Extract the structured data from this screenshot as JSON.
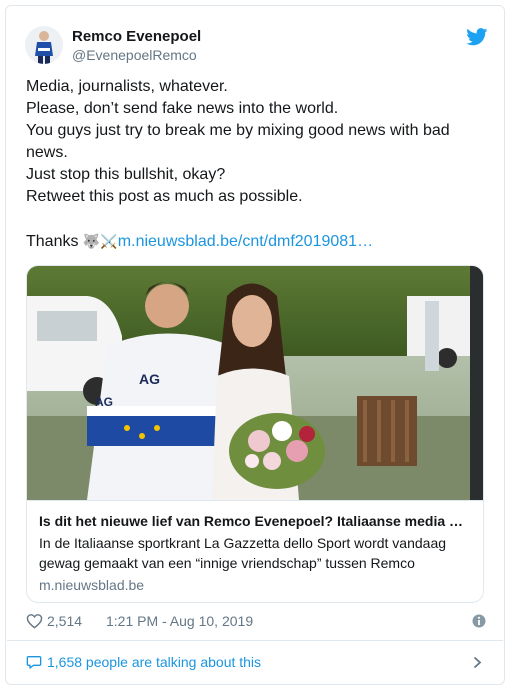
{
  "author": {
    "display_name": "Remco Evenepoel",
    "handle": "@EvenepoelRemco"
  },
  "tweet": {
    "lines": [
      "Media, journalists, whatever.",
      "Please, don’t send fake news into the world.",
      "You guys just try to break me by mixing good news with bad",
      "news.",
      "Just stop this bullshit, okay?",
      "Retweet this post as much as possible."
    ],
    "thanks": "Thanks ",
    "emojis": "🐺⚔️",
    "link_text": "m.nieuwsblad.be/cnt/dmf2019081…"
  },
  "link_card": {
    "title": "Is dit het nieuwe lief van Remco Evenepoel? Italiaanse media …",
    "description": "In de Italiaanse sportkrant La Gazzetta dello Sport wordt vandaag gewag gemaakt van een “innige vriendschap” tussen Remco",
    "domain": "m.nieuwsblad.be",
    "jersey_text_1": "AG",
    "jersey_text_2": "AG"
  },
  "meta": {
    "likes": "2,514",
    "timestamp": "1:21 PM - Aug 10, 2019"
  },
  "footer": {
    "talking_label": "1,658 people are talking about this"
  },
  "colors": {
    "link_blue": "#1b95e0",
    "secondary_text": "#657786",
    "border": "#e1e8ed"
  },
  "icons": [
    "twitter-bird-icon",
    "heart-icon",
    "info-icon",
    "speech-bubble-icon",
    "chevron-right-icon"
  ]
}
